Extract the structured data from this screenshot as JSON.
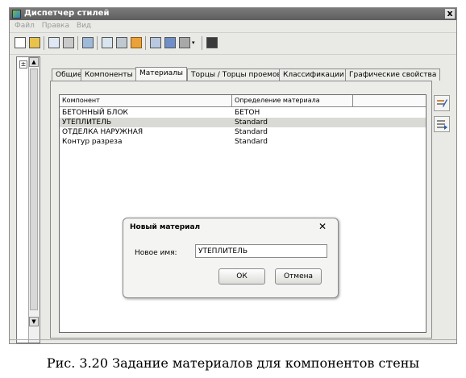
{
  "window": {
    "title": "Диспетчер стилей",
    "close_glyph": "x"
  },
  "menu": [
    "Файл",
    "Правка",
    "Вид"
  ],
  "toolbar_icons": [
    "new-icon",
    "filter-icon",
    "copy-icon",
    "paste-icon",
    "properties-icon",
    "purge-icon",
    "edit-icon",
    "warning-icon",
    "sort-icon",
    "filter-funnel-icon",
    "view-icon",
    "dropdown-icon",
    "film-icon"
  ],
  "tree": {
    "expand_glyph": "±"
  },
  "tabs": [
    {
      "label": "Общие"
    },
    {
      "label": "Компоненты"
    },
    {
      "label": "Материалы"
    },
    {
      "label": "Торцы / Торцы проемов"
    },
    {
      "label": "Классификации"
    },
    {
      "label": "Графические свойства"
    }
  ],
  "active_tab": "Материалы",
  "table": {
    "headers": [
      "Компонент",
      "Определение материала"
    ],
    "rows": [
      {
        "component": "БЕТОННЫЙ БЛОК",
        "material": "БЕТОН"
      },
      {
        "component": "УТЕПЛИТЕЛЬ",
        "material": "Standard"
      },
      {
        "component": "ОТДЕЛКА НАРУЖНАЯ",
        "material": "Standard"
      },
      {
        "component": "Контур разреза",
        "material": "Standard"
      }
    ],
    "selected_row": 1
  },
  "side_buttons": [
    "edit-material-icon",
    "material-list-icon"
  ],
  "dialog": {
    "title": "Новый материал",
    "close_glyph": "✕",
    "name_label": "Новое имя:",
    "name_value": "УТЕПЛИТЕЛЬ",
    "ok_label": "ОК",
    "cancel_label": "Отмена"
  },
  "caption": "Рис. 3.20 Задание материалов для компонентов стены"
}
